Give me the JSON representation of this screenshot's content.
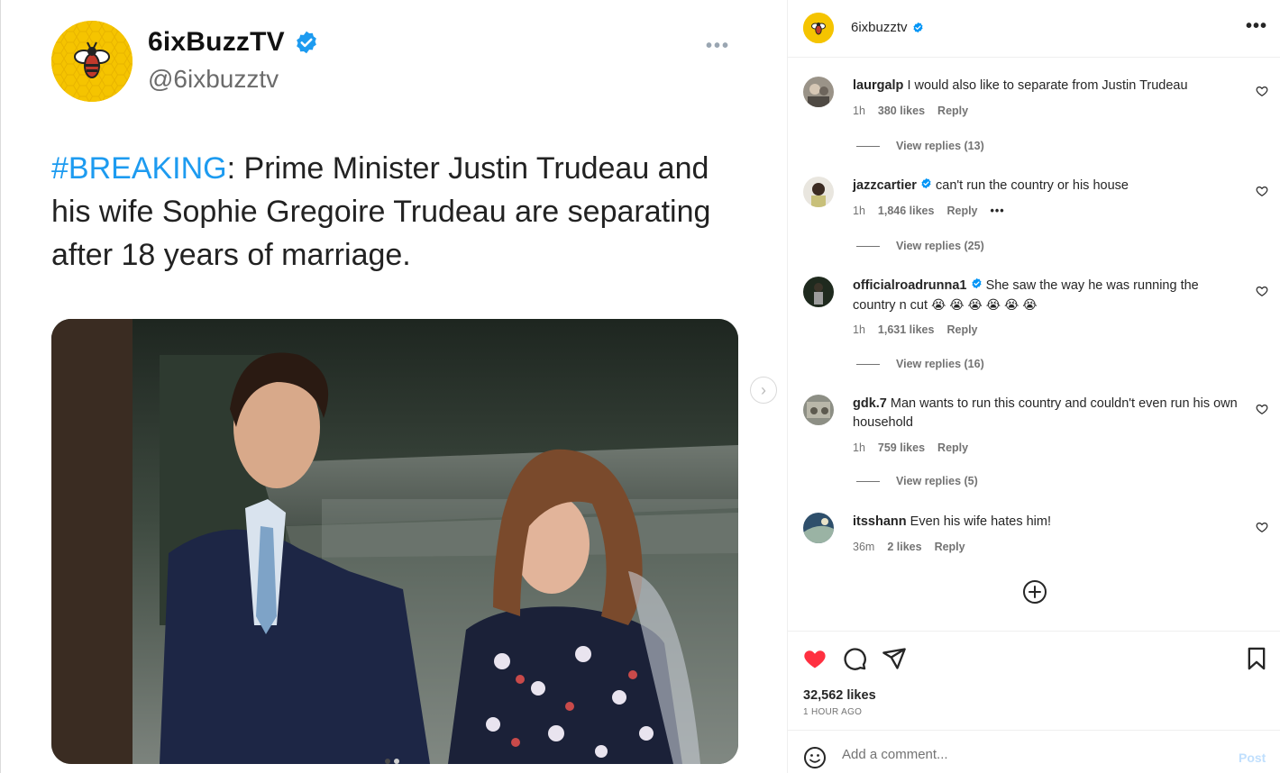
{
  "tweet": {
    "display_name": "6ixBuzzTV",
    "handle": "@6ixbuzztv",
    "more_label": "•••",
    "hashtag": "#BREAKING",
    "text": ": Prime Minister Justin Trudeau and his wife Sophie Gregoire Trudeau are separating after 18 years of marriage."
  },
  "carousel": {
    "next_label": "›"
  },
  "panel": {
    "header": {
      "username": "6ixbuzztv",
      "menu_label": "•••"
    },
    "comments": [
      {
        "username": "laurgalp",
        "verified": false,
        "text": "I would also like to separate from Justin Trudeau",
        "time": "1h",
        "likes": "380 likes",
        "reply_label": "Reply",
        "view_replies": "View replies (13)"
      },
      {
        "username": "jazzcartier",
        "verified": true,
        "text": "can't run the country or his house",
        "time": "1h",
        "likes": "1,846 likes",
        "reply_label": "Reply",
        "more_label": "•••",
        "view_replies": "View replies (25)"
      },
      {
        "username": "officialroadrunna1",
        "verified": true,
        "text": "She saw the way he was running the country n cut",
        "emoji": "😭 😭 😭 😭 😭 😭",
        "time": "1h",
        "likes": "1,631 likes",
        "reply_label": "Reply",
        "view_replies": "View replies (16)"
      },
      {
        "username": "gdk.7",
        "verified": false,
        "text": "Man wants to run this country and couldn't even run his own household",
        "time": "1h",
        "likes": "759 likes",
        "reply_label": "Reply",
        "view_replies": "View replies (5)"
      },
      {
        "username": "itsshann",
        "verified": false,
        "text": "Even his wife hates him!",
        "time": "36m",
        "likes": "2 likes",
        "reply_label": "Reply"
      }
    ],
    "likes_count": "32,562 likes",
    "time_ago": "1 HOUR AGO",
    "comment_placeholder": "Add a comment...",
    "post_label": "Post"
  },
  "colors": {
    "accent_blue": "#0095f6",
    "verified_blue": "#1d9bf0",
    "like_red": "#ff3040",
    "brand_yellow": "#f5c400"
  }
}
